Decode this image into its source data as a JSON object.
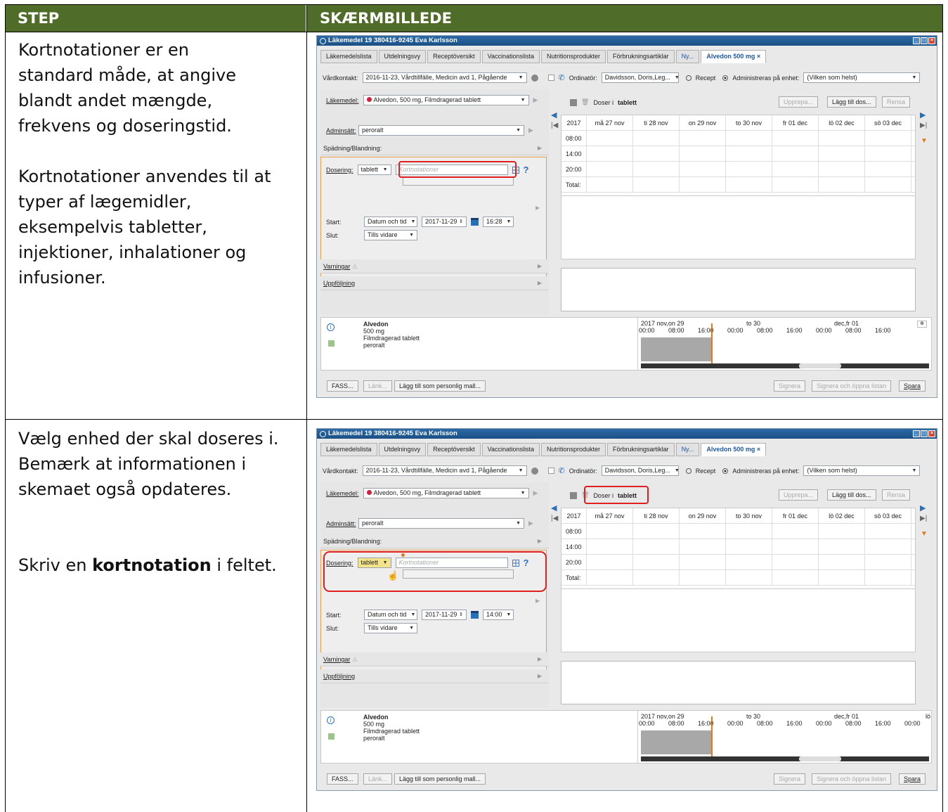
{
  "table": {
    "col_step": "STEP",
    "col_screenshot": "SKÆRMBILLEDE"
  },
  "rows": [
    {
      "step_lines": [
        "Kortnotationer er en",
        "standard måde, at angive",
        "blandt andet mængde,",
        "frekvens og doseringstid.",
        "",
        "Kortnotationer anvendes til at",
        "typer af lægemidler,",
        "eksempelvis tabletter,",
        "injektioner, inhalationer og",
        "infusioner."
      ],
      "window": {
        "title": "Läkemedel 19 380416-9245 Eva Karlsson",
        "tabs": [
          "Läkemedelslista",
          "Utdelningsvy",
          "Receptöversikt",
          "Vaccinationslista",
          "Nutritionsprodukter",
          "Förbrukningsartiklar",
          "Ny...",
          "Alvedon 500 mg ×"
        ],
        "vardkontakt_label": "Vårdkontakt:",
        "vardkontakt_value": "2016-11-23, Vårdtillfälle, Medicin avd 1, Pågående",
        "ordinator_label": "Ordinatör:",
        "ordinator_value": "Davidsson, Doris,Leg...",
        "recept": "Recept",
        "adm_enhet": "Administreras på enhet:",
        "enhet_value": "(Vilken som helst)",
        "lakemedel_label": "Läkemedel:",
        "lakemedel_value": "Alvedon, 500 mg, Filmdragerad tablett",
        "adminsatt_label": "Adminsätt:",
        "adminsatt_value": "peroralt",
        "spadning": "Spädning/Blandning:",
        "dosering_label": "Dosering:",
        "dosering_unit": "tablett",
        "kortnotation_placeholder": "Kortnotationer",
        "start_label": "Start:",
        "start_type": "Datum och tid",
        "start_date": "2017-11-29",
        "start_time": "16:28",
        "slut_label": "Slut:",
        "slut_value": "Tills vidare",
        "varningar": "Varningar",
        "uppfoljning": "Uppföljning",
        "doser_label": "Doser i",
        "doser_unit": "tablett",
        "btn_upprepa": "Upprepa...",
        "btn_lagg": "Lägg till dos...",
        "btn_rensa": "Rensa",
        "year": "2017",
        "days": [
          "må 27 nov",
          "ti 28 nov",
          "on 29 nov",
          "to 30 nov",
          "fr 01 dec",
          "lö 02 dec",
          "sö 03 dec"
        ],
        "times": [
          "08:00",
          "14:00",
          "20:00",
          "Total:"
        ],
        "tl_name": "Alvedon",
        "tl_lines": [
          "500 mg",
          "Filmdragerad tablett",
          "peroralt"
        ],
        "tl_heads": [
          "2017 nov,on 29",
          "to 30",
          "dec,fr 01"
        ],
        "tl_times": [
          "00:00",
          "08:00",
          "16:00",
          "00:00",
          "08:00",
          "16:00",
          "00:00",
          "08:00",
          "16:00"
        ],
        "btn_fass": "FASS...",
        "btn_lank": "Länk...",
        "btn_mall": "Lägg till som personlig mall...",
        "btn_signera": "Signera",
        "btn_signera_oppna": "Signera och öppna listan",
        "btn_spara": "Spara"
      }
    },
    {
      "step_lines": [
        "Vælg enhed der skal doseres i.",
        "Bemærk at informationen i",
        "skemaet også opdateres.",
        "",
        "",
        "Skriv en ",
        "kortnotation",
        " i feltet."
      ],
      "window": {
        "title": "Läkemedel 19 380416-9245 Eva Karlsson",
        "tabs": [
          "Läkemedelslista",
          "Utdelningsvy",
          "Receptöversikt",
          "Vaccinationslista",
          "Nutritionsprodukter",
          "Förbrukningsartiklar",
          "Ny...",
          "Alvedon 500 mg ×"
        ],
        "vardkontakt_label": "Vårdkontakt:",
        "vardkontakt_value": "2016-11-23, Vårdtillfälle, Medicin avd 1, Pågående",
        "ordinator_label": "Ordinatör:",
        "ordinator_value": "Davidsson, Doris,Leg...",
        "recept": "Recept",
        "adm_enhet": "Administreras på enhet:",
        "enhet_value": "(Vilken som helst)",
        "lakemedel_label": "Läkemedel:",
        "lakemedel_value": "Alvedon, 500 mg, Filmdragerad tablett",
        "adminsatt_label": "Adminsätt:",
        "adminsatt_value": "peroralt",
        "spadning": "Spädning/Blandning:",
        "dosering_label": "Dosering:",
        "dosering_unit": "tablett",
        "kortnotation_placeholder": "Kortnotationer",
        "start_label": "Start:",
        "start_type": "Datum och tid",
        "start_date": "2017-11-29",
        "start_time": "14:00",
        "slut_label": "Slut:",
        "slut_value": "Tills vidare",
        "varningar": "Varningar",
        "uppfoljning": "Uppföljning",
        "doser_label": "Doser i",
        "doser_unit": "tablett",
        "btn_upprepa": "Upprepa...",
        "btn_lagg": "Lägg till dos...",
        "btn_rensa": "Rensa",
        "year": "2017",
        "days": [
          "må 27 nov",
          "ti 28 nov",
          "on 29 nov",
          "to 30 nov",
          "fr 01 dec",
          "lö 02 dec",
          "sö 03 dec"
        ],
        "times": [
          "08:00",
          "14:00",
          "20:00",
          "Total:"
        ],
        "tl_name": "Alvedon",
        "tl_lines": [
          "500 mg",
          "Filmdragerad tablett",
          "peroralt"
        ],
        "tl_heads": [
          "2017 nov,on 29",
          "to 30",
          "dec,fr 01",
          "lö"
        ],
        "tl_times": [
          "00:00",
          "08:00",
          "16:00",
          "00:00",
          "08:00",
          "16:00",
          "00:00",
          "08:00",
          "16:00",
          "00:00"
        ],
        "btn_fass": "FASS...",
        "btn_lank": "Länk...",
        "btn_mall": "Lägg till som personlig mall...",
        "btn_signera": "Signera",
        "btn_signera_oppna": "Signera och öppna listan",
        "btn_spara": "Spara"
      }
    }
  ]
}
